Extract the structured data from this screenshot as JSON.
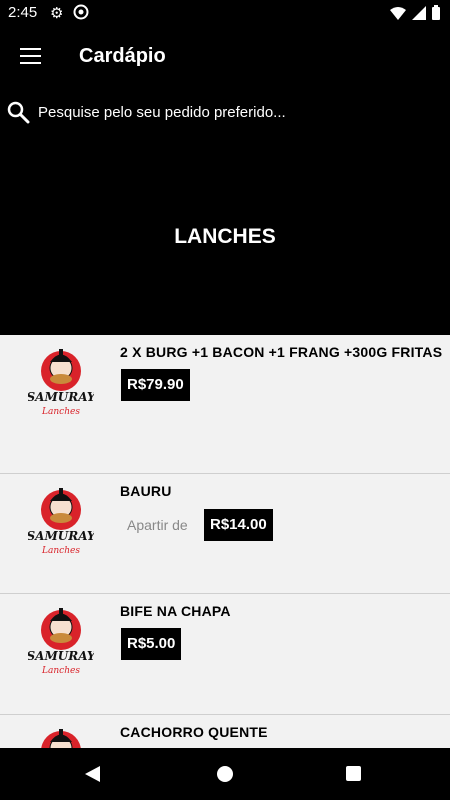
{
  "status_bar": {
    "time": "2:45",
    "icons": [
      "gear-icon",
      "accessibility-icon",
      "wifi-icon",
      "signal-icon",
      "battery-icon"
    ]
  },
  "app_bar": {
    "title": "Cardápio",
    "menu_icon": "hamburger-menu-icon"
  },
  "search": {
    "placeholder": "Pesquise pelo seu pedido preferido..."
  },
  "category": {
    "title": "LANCHES"
  },
  "items": [
    {
      "name": "2 X BURG +1 BACON +1 FRANG +300G FRITAS",
      "price_prefix": "",
      "price": "R$79.90"
    },
    {
      "name": "BAURU",
      "price_prefix": "Apartir de",
      "price": "R$14.00"
    },
    {
      "name": "BIFE NA CHAPA",
      "price_prefix": "",
      "price": "R$5.00"
    },
    {
      "name": "CACHORRO QUENTE",
      "price_prefix": "",
      "price": ""
    }
  ],
  "logo": {
    "brand": "SAMURAY",
    "sub": "Lanches",
    "colors": {
      "red": "#d9232a",
      "black": "#111111"
    }
  },
  "colors": {
    "background": "#000000",
    "list_background": "#f2f2f2",
    "price_badge": "#000000"
  }
}
